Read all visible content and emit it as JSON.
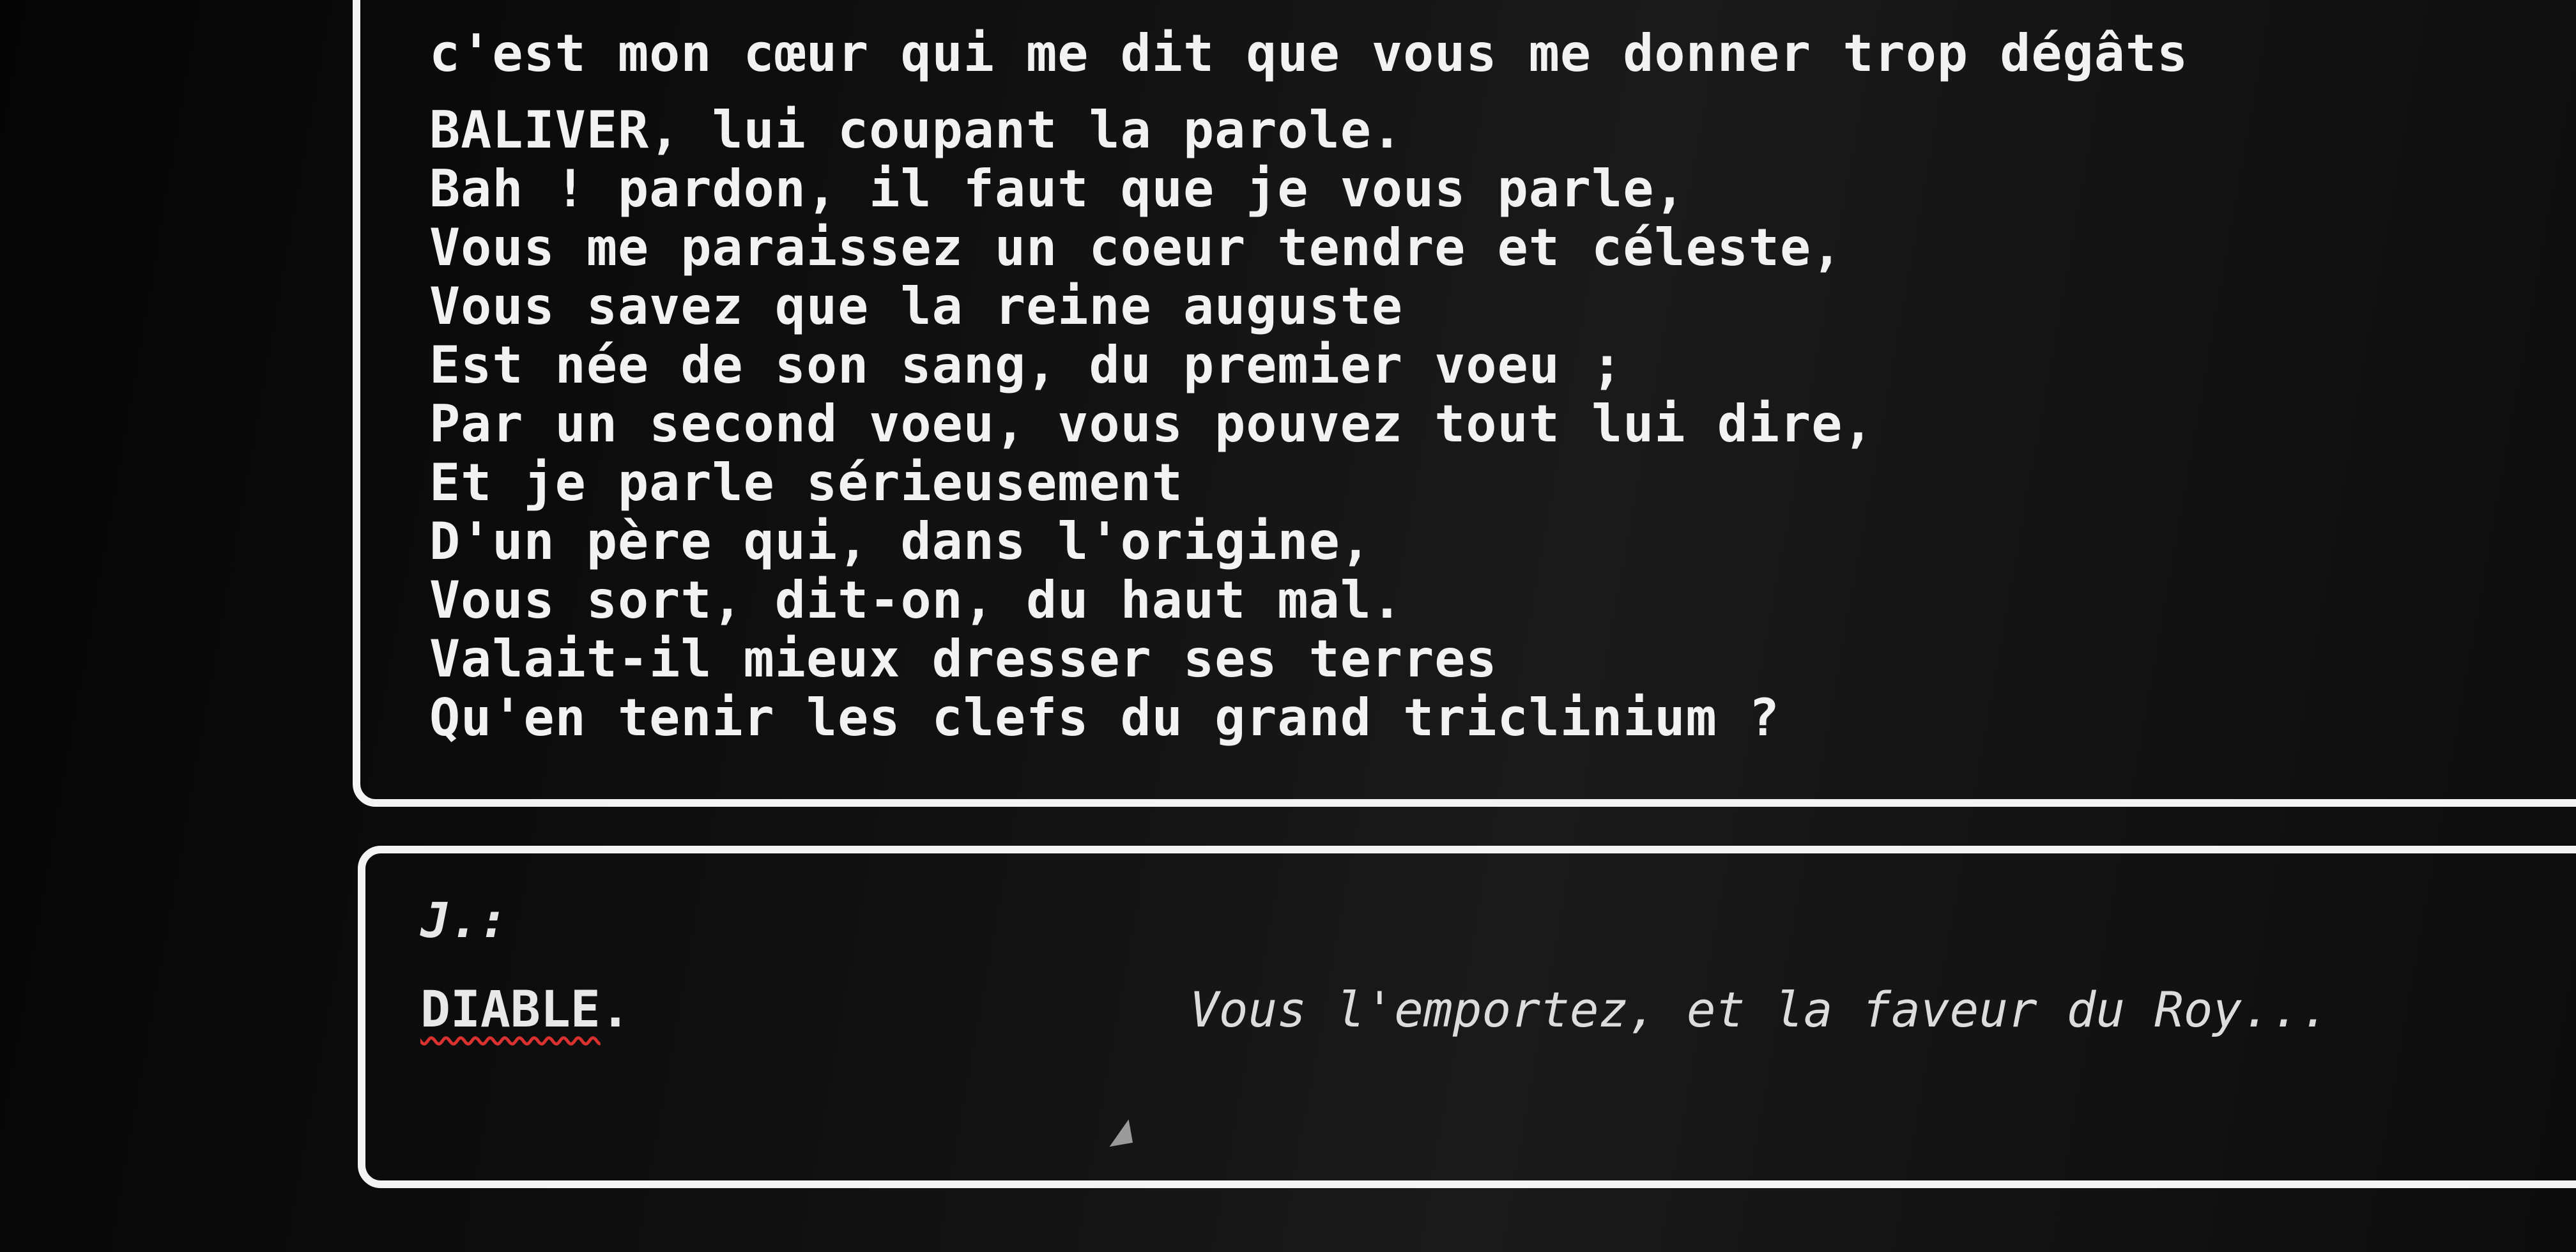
{
  "output": {
    "lines": [
      "c'est mon cœur qui me dit que vous me donner trop dégâts",
      "BALIVER, lui coupant la parole.",
      "Bah ! pardon, il faut que je vous parle,",
      "Vous me paraissez un coeur tendre et céleste,",
      "Vous savez que la reine auguste",
      "Est née de son sang, du premier voeu ;",
      "Par un second voeu, vous pouvez tout lui dire,",
      "Et je parle sérieusement",
      "D'un père qui, dans l'origine,",
      "Vous sort, dit-on, du haut mal.",
      "Valait-il mieux dresser ses terres",
      "Qu'en tenir les clefs du grand triclinium ?"
    ]
  },
  "input": {
    "prompt_label": "J.:",
    "speaker_name": "DIABLE",
    "speaker_suffix": ".",
    "text": "Vous l'emportez, et la faveur du Roy..."
  },
  "colors": {
    "background": "#070707",
    "text": "#f2f2f2",
    "border": "#f4f4f4",
    "spellcheck_underline": "#d93030"
  },
  "icons": {
    "resize_grip": "resize-grip-icon"
  }
}
